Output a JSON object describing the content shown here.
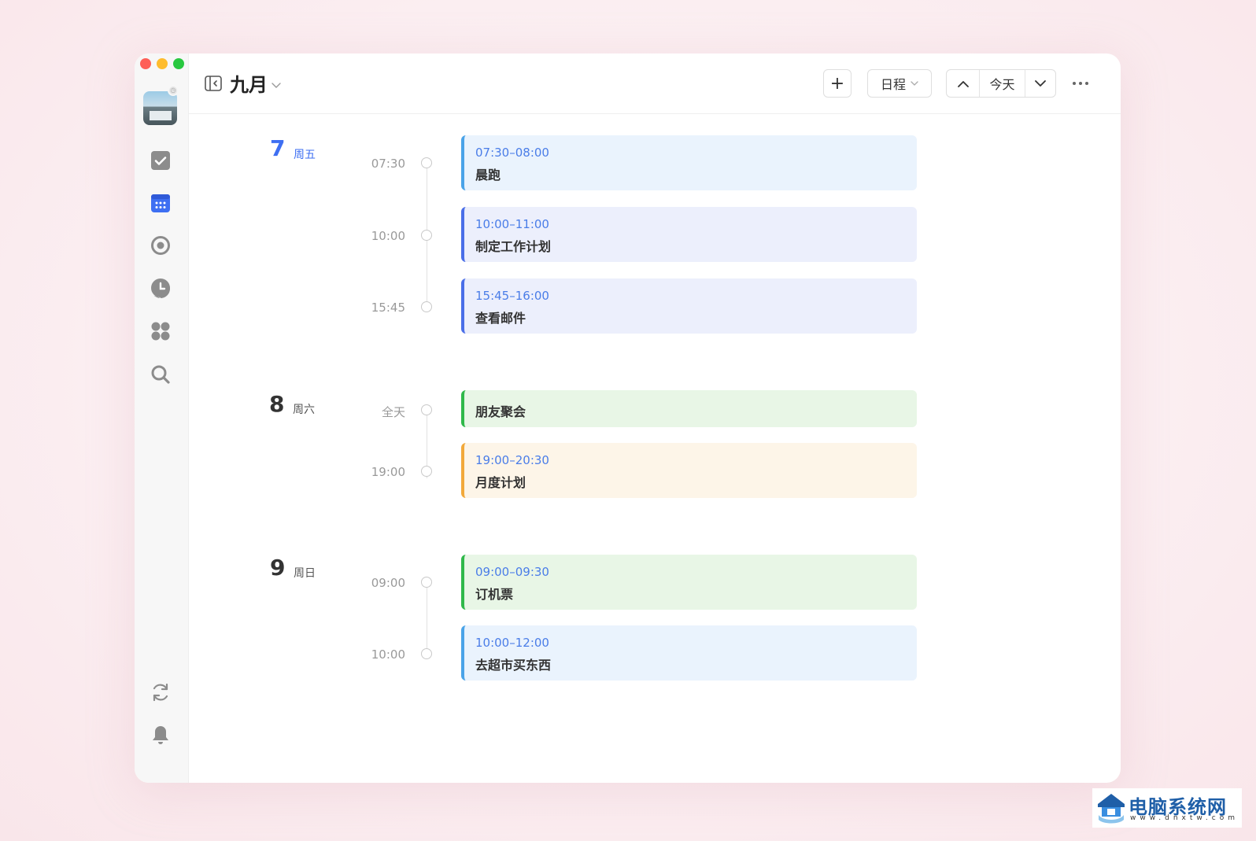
{
  "header": {
    "month": "九月",
    "add_label": "+",
    "view_label": "日程",
    "today_label": "今天"
  },
  "days": [
    {
      "num": "7",
      "weekday": "周五",
      "is_today": true,
      "events": [
        {
          "time_label": "07:30",
          "range": "07:30–08:00",
          "title": "晨跑",
          "color": "#4aa3e8",
          "bg": "#eaf3fd"
        },
        {
          "time_label": "10:00",
          "range": "10:00–11:00",
          "title": "制定工作计划",
          "color": "#4a6ee8",
          "bg": "#eceffc"
        },
        {
          "time_label": "15:45",
          "range": "15:45–16:00",
          "title": "查看邮件",
          "color": "#4a6ee8",
          "bg": "#eceffc"
        }
      ]
    },
    {
      "num": "8",
      "weekday": "周六",
      "is_today": false,
      "events": [
        {
          "time_label": "全天",
          "range": "",
          "title": "朋友聚会",
          "color": "#2fb84a",
          "bg": "#e8f6e6"
        },
        {
          "time_label": "19:00",
          "range": "19:00–20:30",
          "title": "月度计划",
          "color": "#f2a93b",
          "bg": "#fdf5e8"
        }
      ]
    },
    {
      "num": "9",
      "weekday": "周日",
      "is_today": false,
      "events": [
        {
          "time_label": "09:00",
          "range": "09:00–09:30",
          "title": "订机票",
          "color": "#2fb84a",
          "bg": "#e8f6e6"
        },
        {
          "time_label": "10:00",
          "range": "10:00–12:00",
          "title": "去超市买东西",
          "color": "#4aa3e8",
          "bg": "#eaf3fd"
        }
      ]
    }
  ],
  "sidebar_icons": [
    "task-icon",
    "calendar-icon",
    "focus-icon",
    "clock-icon",
    "apps-icon",
    "search-icon",
    "sync-icon",
    "bell-icon"
  ],
  "watermark": {
    "text": "电脑系统网",
    "sub": "www.dnxtw.com"
  }
}
